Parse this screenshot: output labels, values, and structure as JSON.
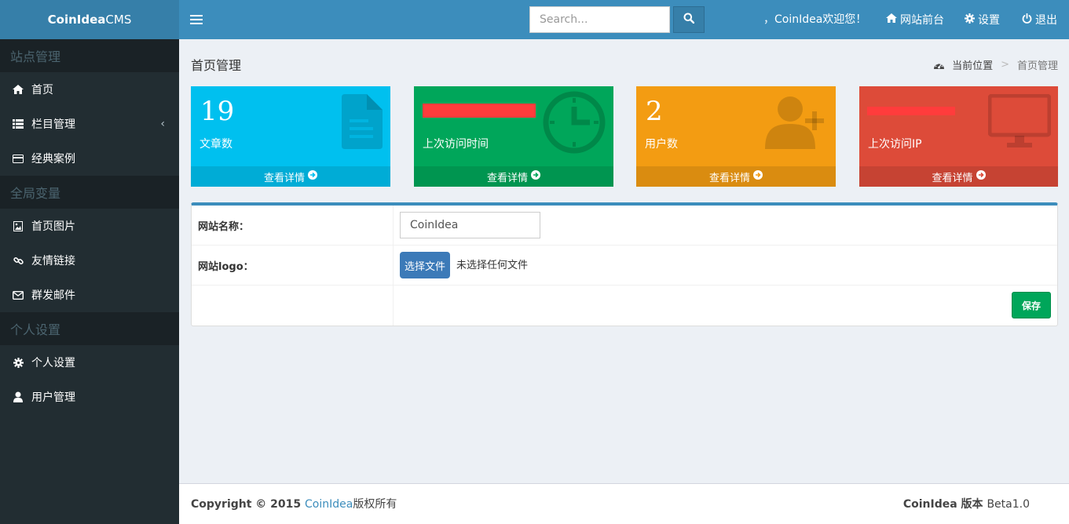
{
  "app": {
    "brand_bold": "CoinIdea",
    "brand_rest": "CMS"
  },
  "header": {
    "search_placeholder": "Search...",
    "welcome": "，CoinIdea欢迎您！",
    "frontend_label": "网站前台",
    "settings_label": "设置",
    "logout_label": "退出"
  },
  "sidebar": {
    "sections": [
      {
        "title": "站点管理"
      },
      {
        "title": "全局变量"
      },
      {
        "title": "个人设置"
      }
    ],
    "items": [
      {
        "label": "首页",
        "icon": "home-icon"
      },
      {
        "label": "栏目管理",
        "icon": "list-icon"
      },
      {
        "label": "经典案例",
        "icon": "credit-card-icon"
      },
      {
        "label": "首页图片",
        "icon": "image-icon"
      },
      {
        "label": "友情链接",
        "icon": "link-icon"
      },
      {
        "label": "群发邮件",
        "icon": "envelope-icon"
      },
      {
        "label": "个人设置",
        "icon": "gear-icon"
      },
      {
        "label": "用户管理",
        "icon": "user-icon"
      }
    ]
  },
  "page": {
    "title": "首页管理",
    "breadcrumb": {
      "location_label": "当前位置",
      "current": "首页管理"
    }
  },
  "stats": [
    {
      "value": "19",
      "label": "文章数",
      "more": "查看详情",
      "color": "#00c0ef",
      "icon": "document-icon"
    },
    {
      "value": "",
      "label": "上次访问时间",
      "more": "查看详情",
      "color": "#00a65a",
      "icon": "clock-icon"
    },
    {
      "value": "2",
      "label": "用户数",
      "more": "查看详情",
      "color": "#f39c12",
      "icon": "user-add-icon"
    },
    {
      "value": "",
      "label": "上次访问IP",
      "more": "查看详情",
      "color": "#dd4b39",
      "icon": "monitor-icon"
    }
  ],
  "form": {
    "site_name_label": "网站名称：",
    "site_name_value": "CoinIdea",
    "logo_label": "网站logo：",
    "choose_file_label": "选择文件",
    "no_file_text": "未选择任何文件",
    "save_label": "保存"
  },
  "footer": {
    "copyright_prefix": "Copyright © 2015 ",
    "copyright_link": "CoinIdea",
    "copyright_suffix": "版权所有",
    "version_name": "CoinIdea",
    "version_label": " 版本 ",
    "version_value": "Beta1.0"
  }
}
